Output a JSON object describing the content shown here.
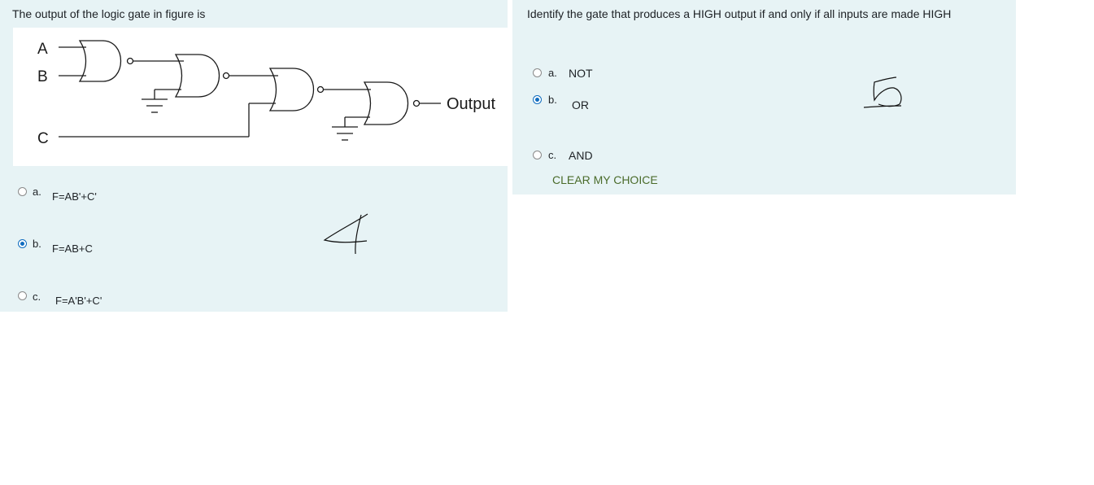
{
  "question1": {
    "text": "The output of the logic gate in figure is",
    "figure": {
      "input_a": "A",
      "input_b": "B",
      "input_c": "C",
      "output": "Output"
    },
    "options": [
      {
        "letter": "a.",
        "text": "F=AB'+C'",
        "selected": false
      },
      {
        "letter": "b.",
        "text": "F=AB+C",
        "selected": true
      },
      {
        "letter": "c.",
        "text": "F=A'B'+C'",
        "selected": false
      }
    ],
    "annotation_icon": "handwritten-4-icon"
  },
  "question2": {
    "text": "Identify the gate that produces a HIGH output if and only if all inputs are made HIGH",
    "options": [
      {
        "letter": "a.",
        "text": "NOT",
        "selected": false
      },
      {
        "letter": "b.",
        "text": "OR",
        "selected": true
      },
      {
        "letter": "c.",
        "text": "AND",
        "selected": false
      }
    ],
    "clear_label": "CLEAR MY CHOICE",
    "annotation_icon": "handwritten-5-icon"
  },
  "colors": {
    "panel_bg": "#e7f3f5",
    "radio_selected": "#0f6cbf",
    "clear_link": "#4a6b2a"
  }
}
